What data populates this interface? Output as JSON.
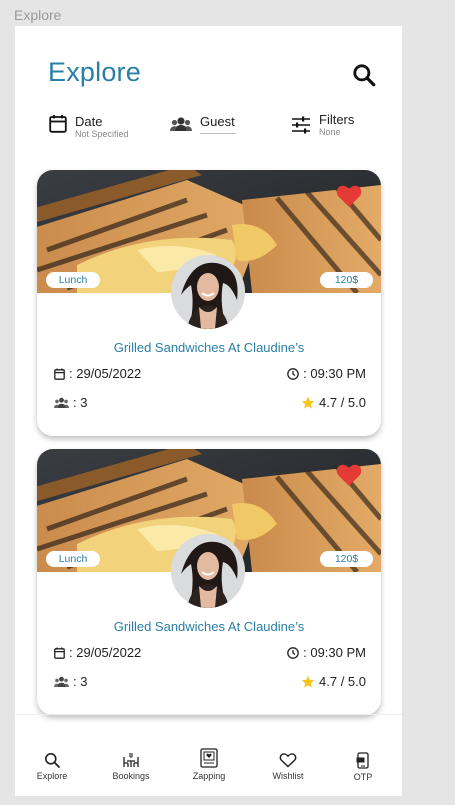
{
  "frame_label": "Explore",
  "header": {
    "title": "Explore"
  },
  "filters": {
    "date": {
      "label": "Date",
      "value": "Not Specified"
    },
    "guest": {
      "label": "Guest"
    },
    "filters": {
      "label": "Filters",
      "value": "None"
    }
  },
  "cards": [
    {
      "tag": "Lunch",
      "price": "120$",
      "title": "Grilled Sandwiches At Claudine’s",
      "date": ": 29/05/2022",
      "time": ": 09:30 PM",
      "guests": ": 3",
      "rating": "4.7 / 5.0",
      "favorite": true
    },
    {
      "tag": "Lunch",
      "price": "120$",
      "title": "Grilled Sandwiches At Claudine’s",
      "date": ": 29/05/2022",
      "time": ": 09:30 PM",
      "guests": ": 3",
      "rating": "4.7 / 5.0",
      "favorite": true
    }
  ],
  "nav": {
    "items": [
      {
        "label": "Explore",
        "icon": "search-icon"
      },
      {
        "label": "Bookings",
        "icon": "dining-icon"
      },
      {
        "label": "Zapping",
        "icon": "zapping-icon"
      },
      {
        "label": "Wishlist",
        "icon": "heart-icon"
      },
      {
        "label": "OTP",
        "icon": "phone-icon"
      }
    ]
  },
  "colors": {
    "accent": "#2a7fa6",
    "heart": "#e53935",
    "star": "#f5c518"
  }
}
